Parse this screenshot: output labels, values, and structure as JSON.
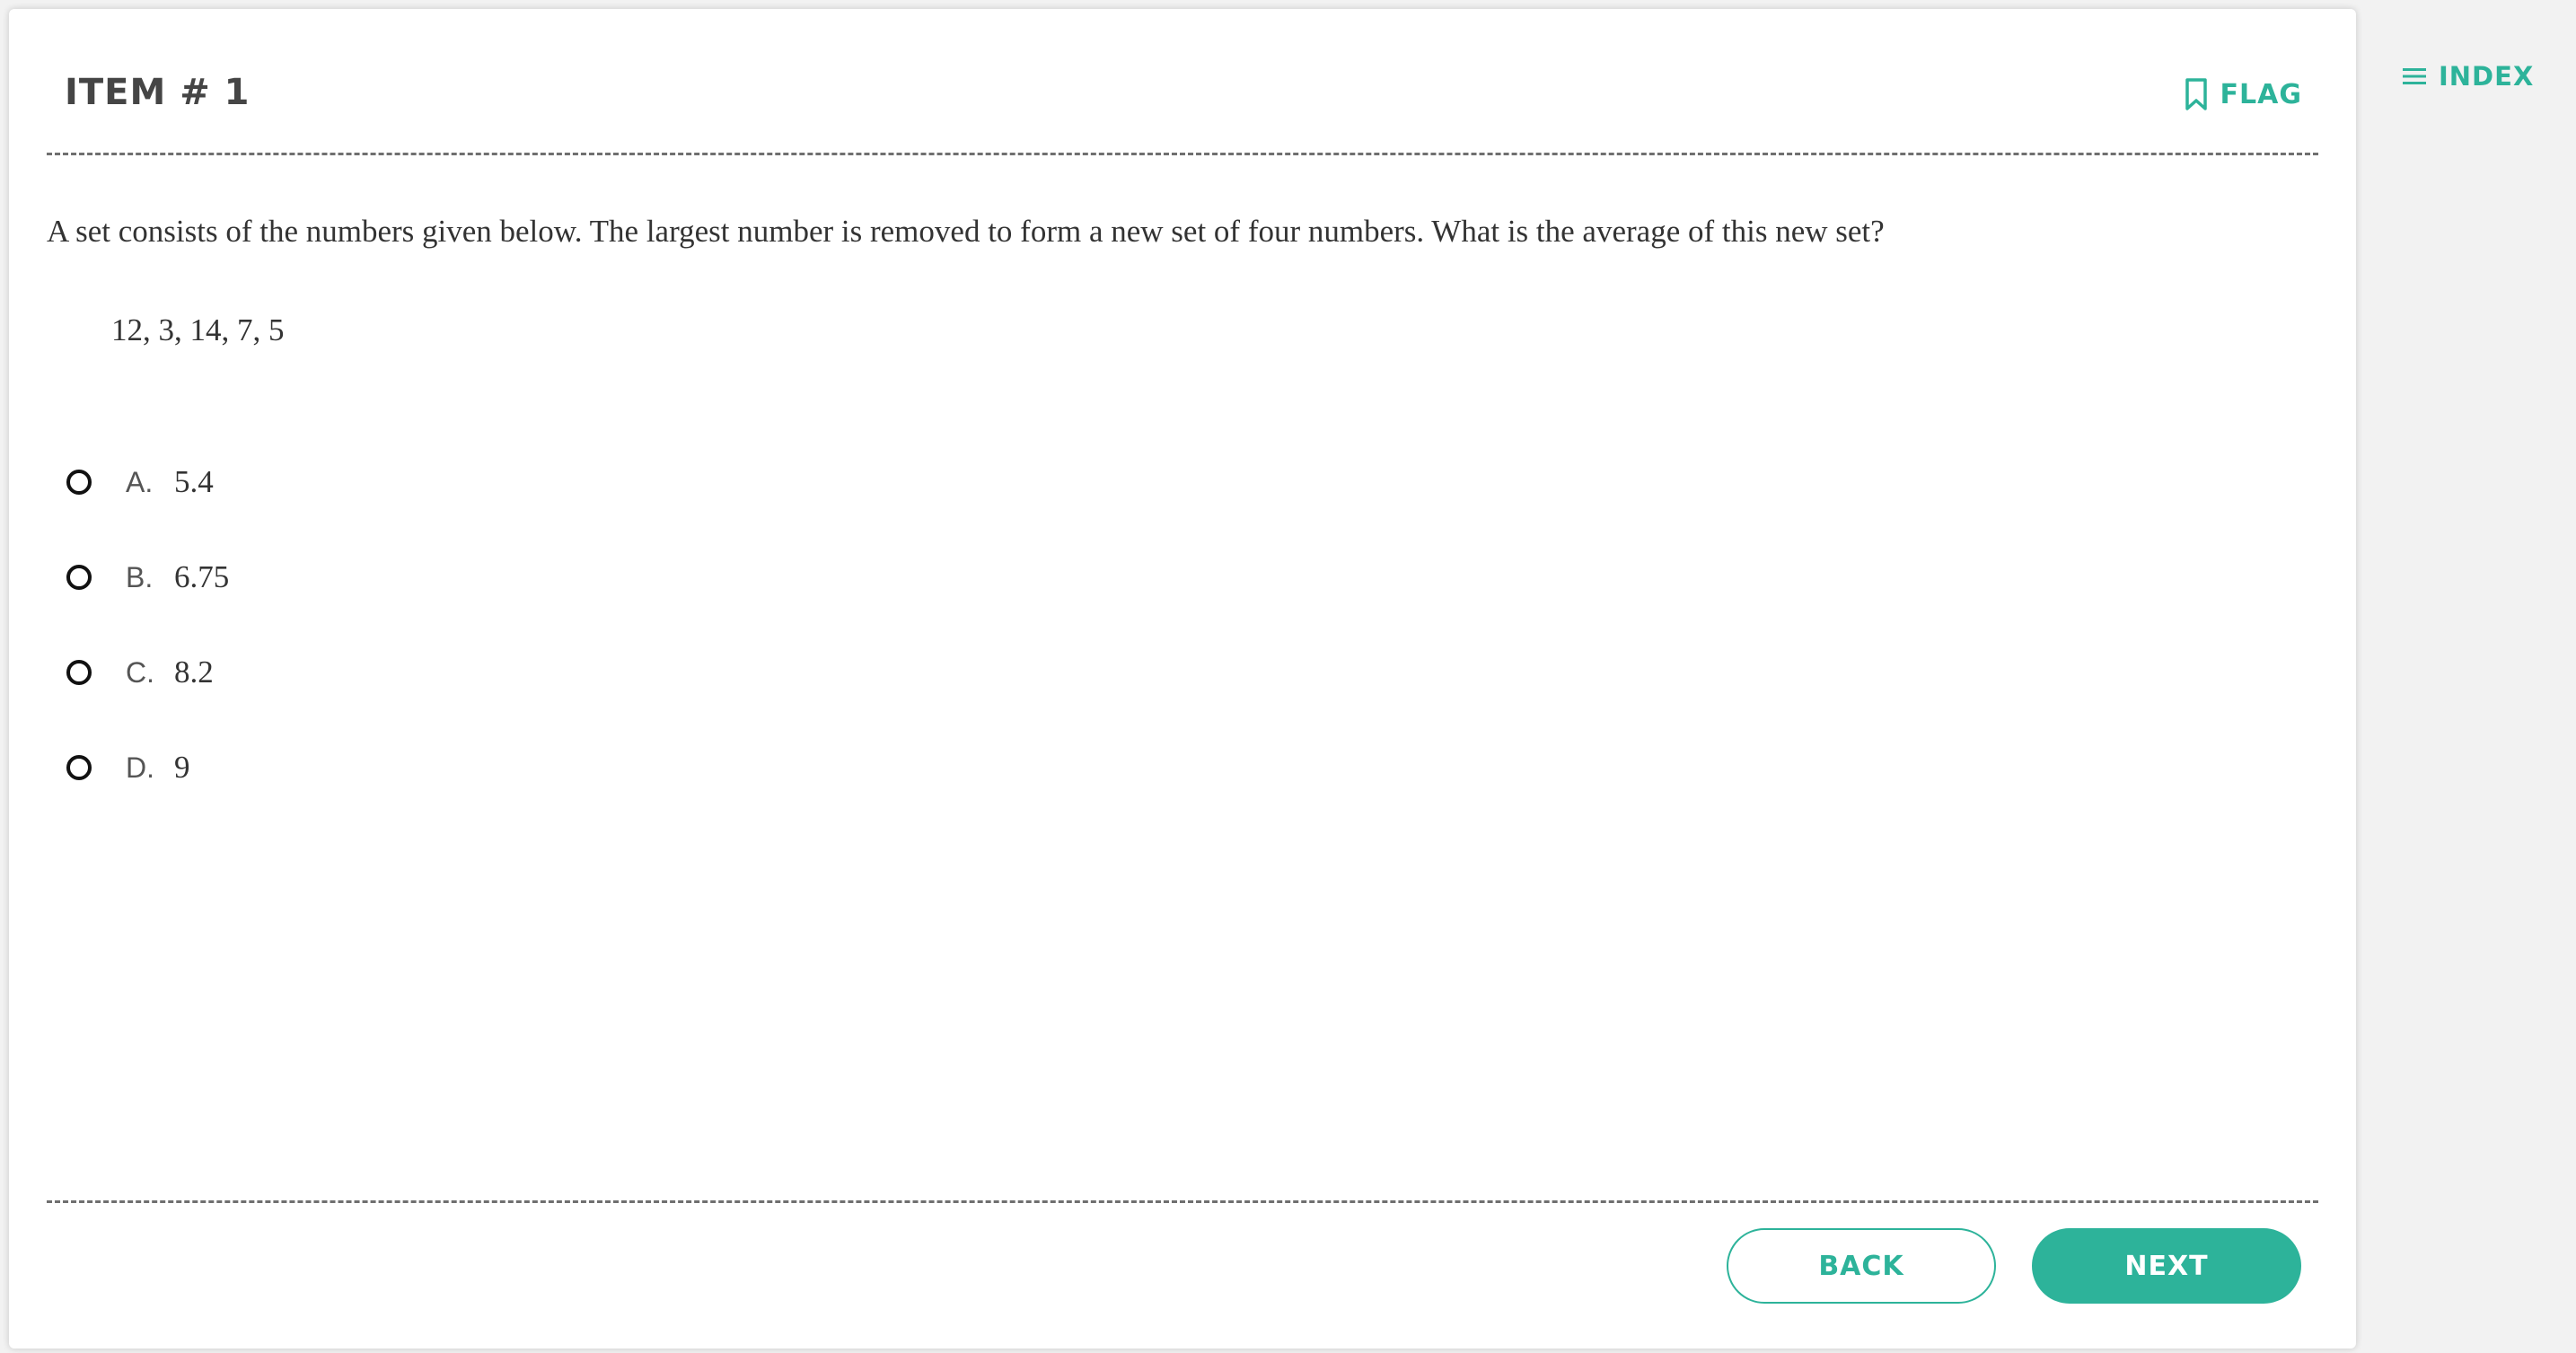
{
  "header": {
    "item_title": "ITEM # 1",
    "flag_label": "FLAG",
    "flag_icon": "bookmark-icon"
  },
  "sidebar": {
    "index_label": "INDEX",
    "index_icon": "menu-icon"
  },
  "question": {
    "prompt": "A set consists of the numbers given below. The largest number is removed to form a new set of four numbers. What is the average of this new set?",
    "numbers": "12, 3, 14, 7, 5",
    "options": [
      {
        "letter": "A.",
        "text": "5.4",
        "selected": false
      },
      {
        "letter": "B.",
        "text": "6.75",
        "selected": false
      },
      {
        "letter": "C.",
        "text": "8.2",
        "selected": false
      },
      {
        "letter": "D.",
        "text": "9",
        "selected": false
      }
    ]
  },
  "footer": {
    "back_label": "BACK",
    "next_label": "NEXT"
  },
  "colors": {
    "accent": "#2db39a",
    "text": "#333333",
    "title": "#454545"
  }
}
